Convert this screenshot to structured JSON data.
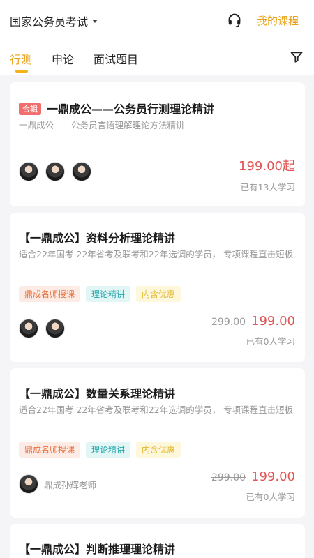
{
  "header": {
    "exam_select": "国家公务员考试",
    "my_course": "我的课程"
  },
  "tabs": [
    {
      "label": "行测"
    },
    {
      "label": "申论"
    },
    {
      "label": "面试题目"
    }
  ],
  "cards": [
    {
      "badge": "合辑",
      "title": "一鼎成公——公务员行测理论精讲",
      "subtitle": "一鼎成公——公务员言语理解理论方法精讲",
      "price": "199.00起",
      "learners": "已有13人学习"
    },
    {
      "title": "【一鼎成公】资料分析理论精讲",
      "subtitle": "适合22年国考 22年省考及联考和22年选调的学员， 专项课程直击短板",
      "tags": [
        "鼎成名师授课",
        "理论精讲",
        "内含优惠"
      ],
      "old_price": "299.00",
      "price": "199.00",
      "learners": "已有0人学习"
    },
    {
      "title": "【一鼎成公】数量关系理论精讲",
      "subtitle": "适合22年国考 22年省考及联考和22年选调的学员， 专项课程直击短板",
      "tags": [
        "鼎成名师授课",
        "理论精讲",
        "内含优惠"
      ],
      "teacher": "鼎成孙辉老师",
      "old_price": "299.00",
      "price": "199.00",
      "learners": "已有0人学习"
    },
    {
      "title": "【一鼎成公】判断推理理论精讲"
    }
  ],
  "colors": {
    "accent": "#e8a21b",
    "price": "#e25555",
    "badge": "#f26d6d"
  }
}
